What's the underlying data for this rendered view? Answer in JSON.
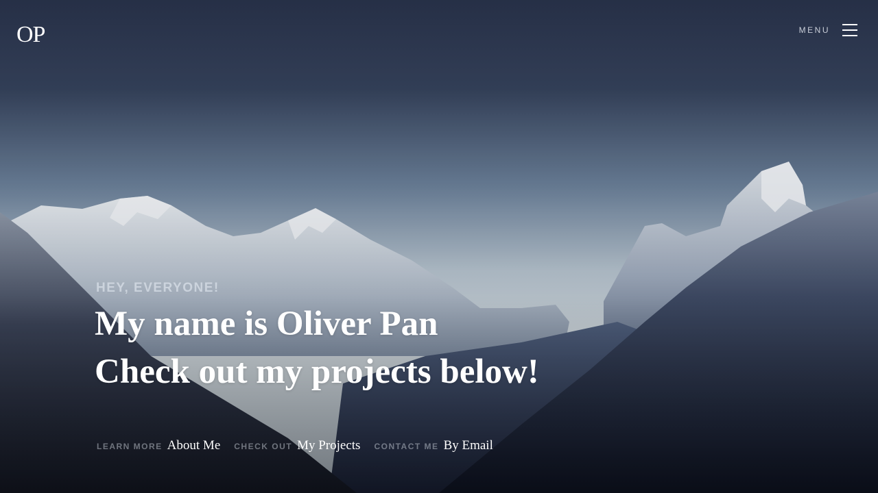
{
  "header": {
    "logo_text": "OP",
    "menu_label": "MENU"
  },
  "hero": {
    "eyebrow": "HEY, EVERYONE!",
    "headline_line1": "My name is Oliver Pan",
    "headline_line2": "Check out my projects below!",
    "background": "snowy-mountain-valley-image"
  },
  "links": [
    {
      "kicker": "LEARN MORE",
      "label": "About Me"
    },
    {
      "kicker": "CHECK OUT",
      "label": "My Projects"
    },
    {
      "kicker": "CONTACT ME",
      "label": "By Email"
    }
  ],
  "colors": {
    "sky_top": "#2b3448",
    "sky_horizon": "#c8d0d8",
    "text": "#ffffff"
  }
}
